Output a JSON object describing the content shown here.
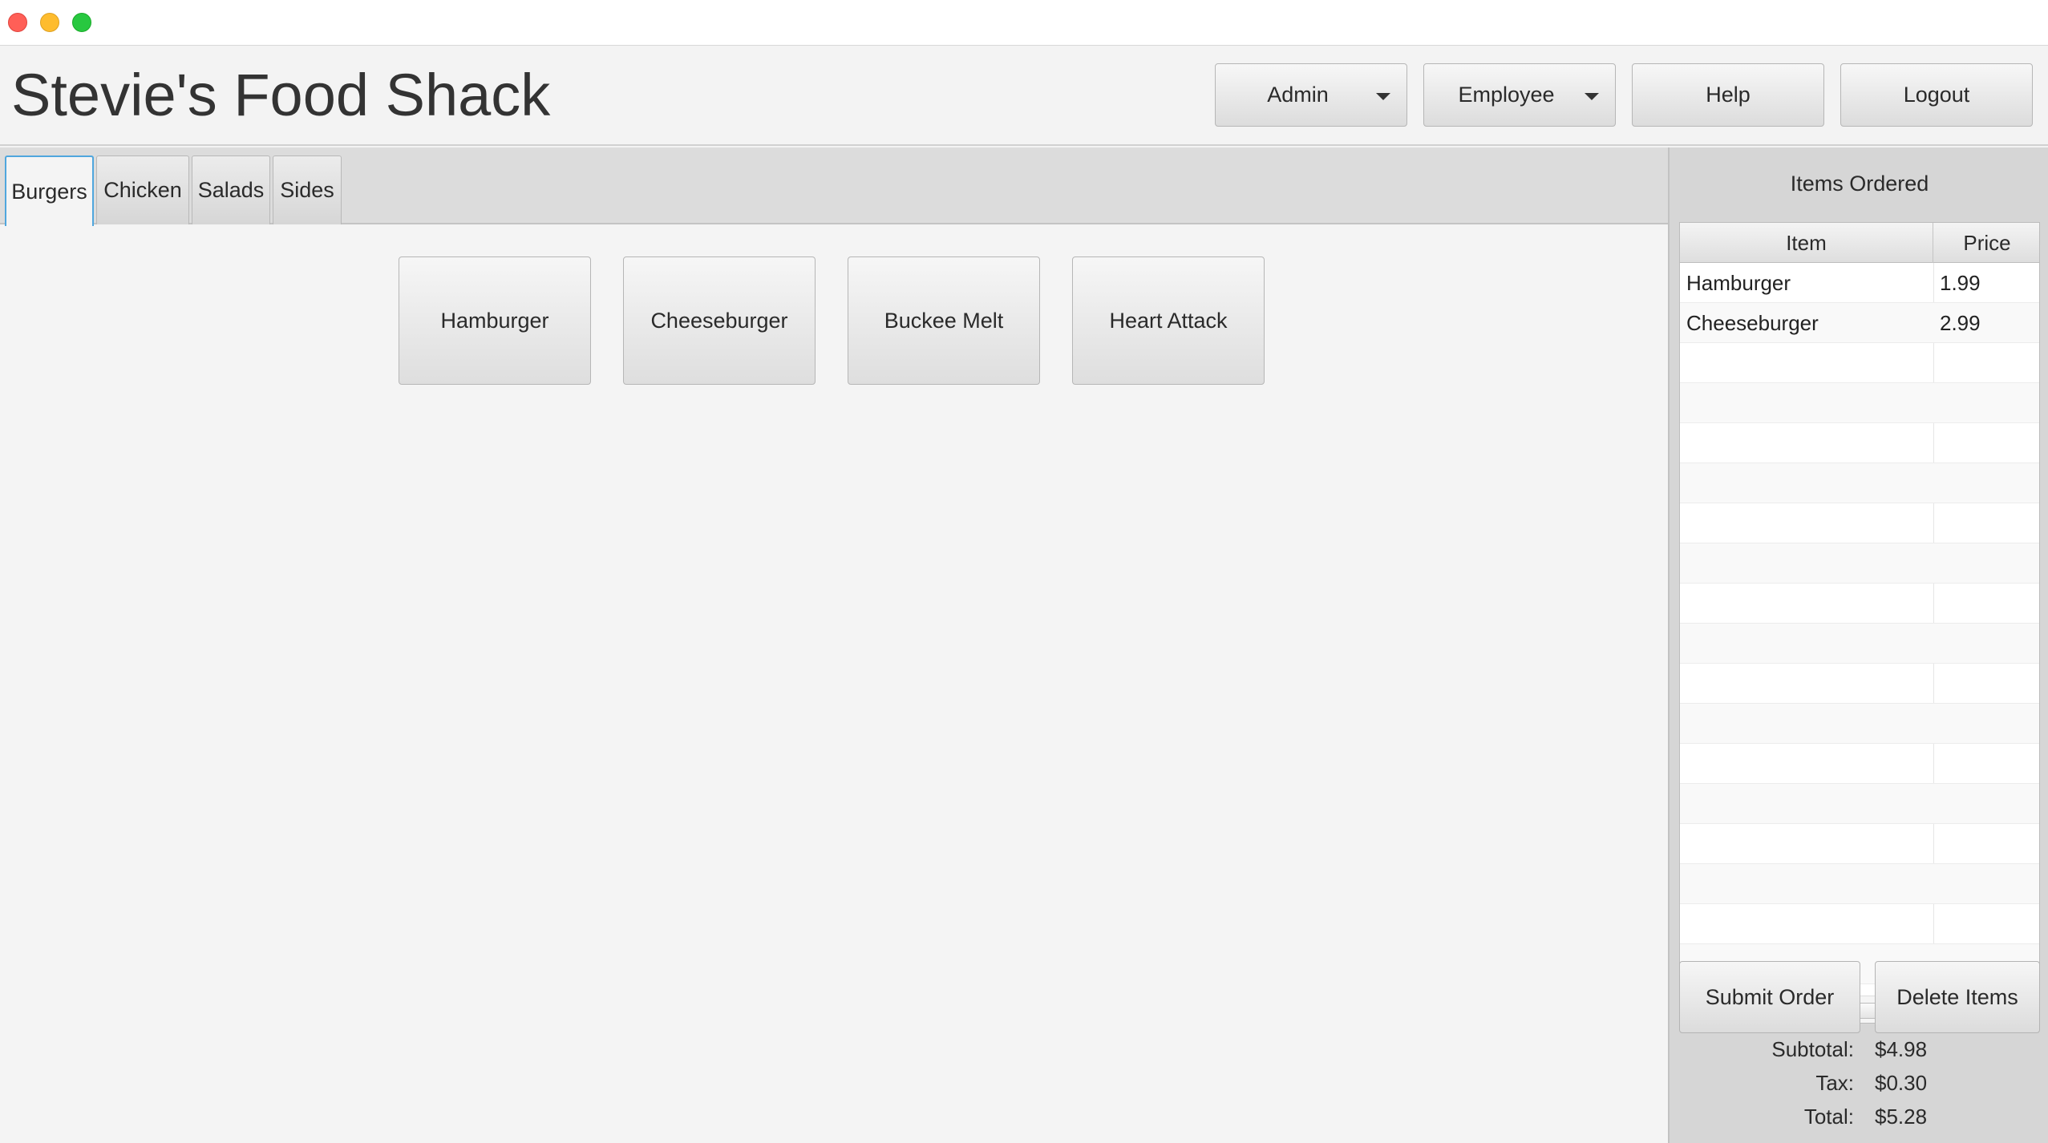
{
  "app": {
    "title": "Stevie's Food Shack"
  },
  "header": {
    "buttons": [
      {
        "label": "Admin",
        "has_menu": true
      },
      {
        "label": "Employee",
        "has_menu": true
      },
      {
        "label": "Help",
        "has_menu": false
      },
      {
        "label": "Logout",
        "has_menu": false
      }
    ]
  },
  "tabs": [
    {
      "label": "Burgers",
      "active": true
    },
    {
      "label": "Chicken",
      "active": false
    },
    {
      "label": "Salads",
      "active": false
    },
    {
      "label": "Sides",
      "active": false
    }
  ],
  "menu_items": [
    "Hamburger",
    "Cheeseburger",
    "Buckee Melt",
    "Heart Attack"
  ],
  "order": {
    "title": "Items Ordered",
    "columns": [
      "Item",
      "Price"
    ],
    "rows": [
      {
        "item": "Hamburger",
        "price": "1.99"
      },
      {
        "item": "Cheeseburger",
        "price": "2.99"
      }
    ],
    "submit_label": "Submit Order",
    "delete_label": "Delete Items",
    "subtotal_label": "Subtotal:",
    "subtotal": "$4.98",
    "tax_label": "Tax:",
    "tax": "$0.30",
    "total_label": "Total:",
    "total": "$5.28"
  },
  "colors": {
    "active_tab_border": "#4fa6dd",
    "close": "#ff5f57",
    "minimize": "#febc2e",
    "maximize": "#28c840"
  }
}
